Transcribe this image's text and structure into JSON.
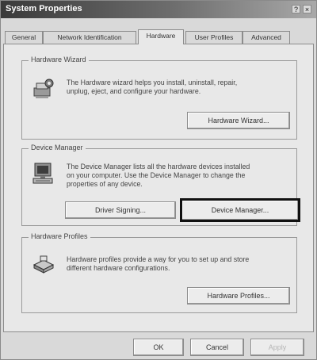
{
  "window": {
    "title": "System Properties",
    "help_button": "?",
    "close_button": "×"
  },
  "tabs": [
    {
      "label": "General",
      "active": false
    },
    {
      "label": "Network Identification",
      "active": false
    },
    {
      "label": "Hardware",
      "active": true
    },
    {
      "label": "User Profiles",
      "active": false
    },
    {
      "label": "Advanced",
      "active": false
    }
  ],
  "hardware_wizard": {
    "title": "Hardware Wizard",
    "description_line1": "The Hardware wizard helps you install, uninstall, repair,",
    "description_line2": "unplug, eject, and configure your hardware.",
    "button_label": "Hardware Wizard...",
    "icon": "hardware-wizard-icon"
  },
  "device_manager": {
    "title": "Device Manager",
    "description_line1": "The Device Manager lists all the hardware devices installed",
    "description_line2": "on your computer. Use the Device Manager to change the",
    "description_line3": "properties of any device.",
    "driver_signing_label": "Driver Signing...",
    "device_manager_label": "Device Manager...",
    "icon": "computer-icon"
  },
  "hardware_profiles": {
    "title": "Hardware Profiles",
    "description_line1": "Hardware profiles provide a way for you to set up and store",
    "description_line2": "different hardware configurations.",
    "button_label": "Hardware Profiles...",
    "icon": "hardware-profiles-icon"
  },
  "footer": {
    "ok_label": "OK",
    "cancel_label": "Cancel",
    "apply_label": "Apply"
  }
}
